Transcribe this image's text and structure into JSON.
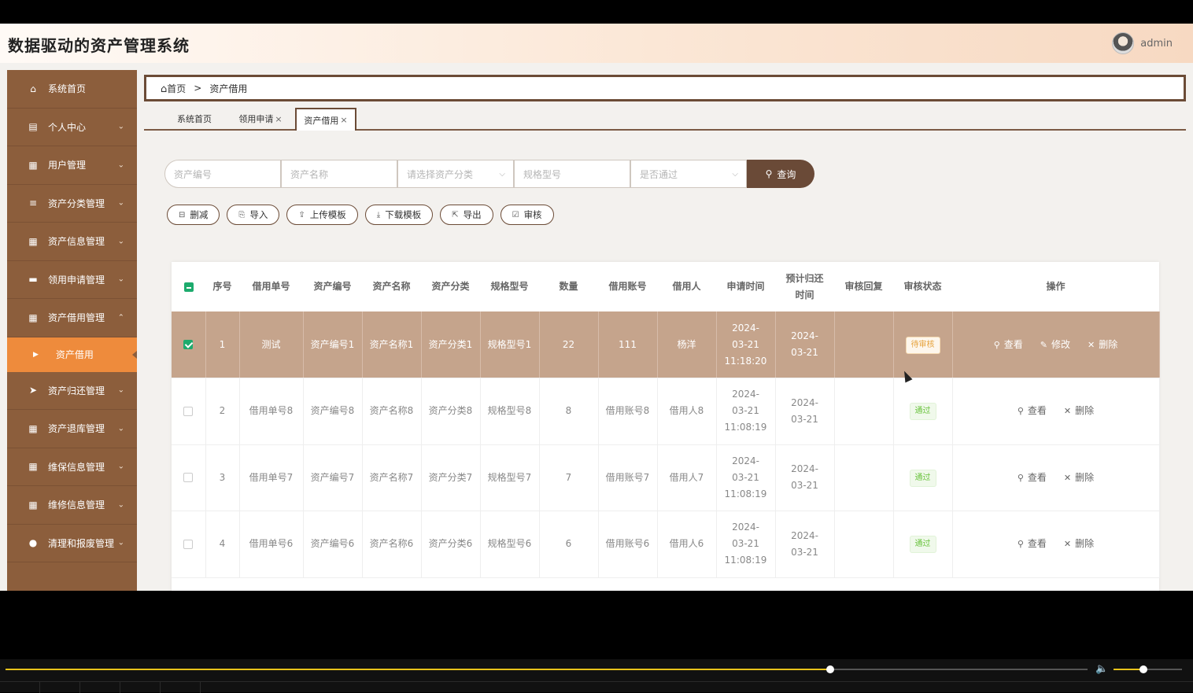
{
  "app": {
    "title": "数据驱动的资产管理系统",
    "user": "admin"
  },
  "sidebar": {
    "items": [
      {
        "label": "系统首页",
        "icon": "home-icon",
        "glyph": "⌂",
        "chevron": ""
      },
      {
        "label": "个人中心",
        "icon": "id-card-icon",
        "glyph": "▤",
        "chevron": "⌄"
      },
      {
        "label": "用户管理",
        "icon": "grid-icon",
        "glyph": "▦",
        "chevron": "⌄"
      },
      {
        "label": "资产分类管理",
        "icon": "list-icon",
        "glyph": "≡",
        "chevron": "⌄"
      },
      {
        "label": "资产信息管理",
        "icon": "grid-icon",
        "glyph": "▦",
        "chevron": "⌄"
      },
      {
        "label": "领用申请管理",
        "icon": "monitor-icon",
        "glyph": "▬",
        "chevron": "⌄"
      },
      {
        "label": "资产借用管理",
        "icon": "grid-icon",
        "glyph": "▦",
        "chevron": "⌃"
      }
    ],
    "active_sub": {
      "label": "资产借用",
      "glyph": "▶"
    },
    "items_after": [
      {
        "label": "资产归还管理",
        "icon": "send-icon",
        "glyph": "➤",
        "chevron": "⌄"
      },
      {
        "label": "资产退库管理",
        "icon": "grid-icon",
        "glyph": "▦",
        "chevron": "⌄"
      },
      {
        "label": "维保信息管理",
        "icon": "grid-icon",
        "glyph": "▦",
        "chevron": "⌄"
      },
      {
        "label": "维修信息管理",
        "icon": "grid-icon",
        "glyph": "▦",
        "chevron": "⌄"
      },
      {
        "label": "清理和报废管理",
        "icon": "user-icon",
        "glyph": "●",
        "chevron": "⌄"
      }
    ]
  },
  "breadcrumb": {
    "home": "首页",
    "sep": ">",
    "current": "资产借用"
  },
  "tabs": [
    {
      "label": "系统首页",
      "close": ""
    },
    {
      "label": "领用申请",
      "close": "×"
    },
    {
      "label": "资产借用",
      "close": "×"
    }
  ],
  "search": {
    "asset_no_placeholder": "资产编号",
    "asset_name_placeholder": "资产名称",
    "category_placeholder": "请选择资产分类",
    "spec_placeholder": "规格型号",
    "passed_placeholder": "是否通过",
    "query_label": "查询"
  },
  "actions": {
    "delete": "删减",
    "import": "导入",
    "upload_template": "上传模板",
    "download_template": "下载模板",
    "export": "导出",
    "audit": "审核"
  },
  "table": {
    "headers": [
      "序号",
      "借用单号",
      "资产编号",
      "资产名称",
      "资产分类",
      "规格型号",
      "数量",
      "借用账号",
      "借用人",
      "申请时间",
      "预计归还时间",
      "审核回复",
      "审核状态",
      "操作"
    ],
    "rows": [
      {
        "idx": "1",
        "order_no": "测试",
        "asset_no": "资产编号1",
        "asset_name": "资产名称1",
        "category": "资产分类1",
        "spec": "规格型号1",
        "qty": "22",
        "account": "111",
        "borrower": "杨洋",
        "apply_time": "2024-03-21 11:18:20",
        "return_time": "2024-03-21",
        "reply": "",
        "status": "待审核",
        "ops": [
          "查看",
          "修改",
          "删除"
        ]
      },
      {
        "idx": "2",
        "order_no": "借用单号8",
        "asset_no": "资产编号8",
        "asset_name": "资产名称8",
        "category": "资产分类8",
        "spec": "规格型号8",
        "qty": "8",
        "account": "借用账号8",
        "borrower": "借用人8",
        "apply_time": "2024-03-21 11:08:19",
        "return_time": "2024-03-21",
        "reply": "",
        "status": "通过",
        "ops": [
          "查看",
          "删除"
        ]
      },
      {
        "idx": "3",
        "order_no": "借用单号7",
        "asset_no": "资产编号7",
        "asset_name": "资产名称7",
        "category": "资产分类7",
        "spec": "规格型号7",
        "qty": "7",
        "account": "借用账号7",
        "borrower": "借用人7",
        "apply_time": "2024-03-21 11:08:19",
        "return_time": "2024-03-21",
        "reply": "",
        "status": "通过",
        "ops": [
          "查看",
          "删除"
        ]
      },
      {
        "idx": "4",
        "order_no": "借用单号6",
        "asset_no": "资产编号6",
        "asset_name": "资产名称6",
        "category": "资产分类6",
        "spec": "规格型号6",
        "qty": "6",
        "account": "借用账号6",
        "borrower": "借用人6",
        "apply_time": "2024-03-21 11:08:19",
        "return_time": "2024-03-21",
        "reply": "",
        "status": "通过",
        "ops": [
          "查看",
          "删除"
        ]
      }
    ]
  },
  "player": {
    "progress": 0.762,
    "volume": 0.44
  }
}
